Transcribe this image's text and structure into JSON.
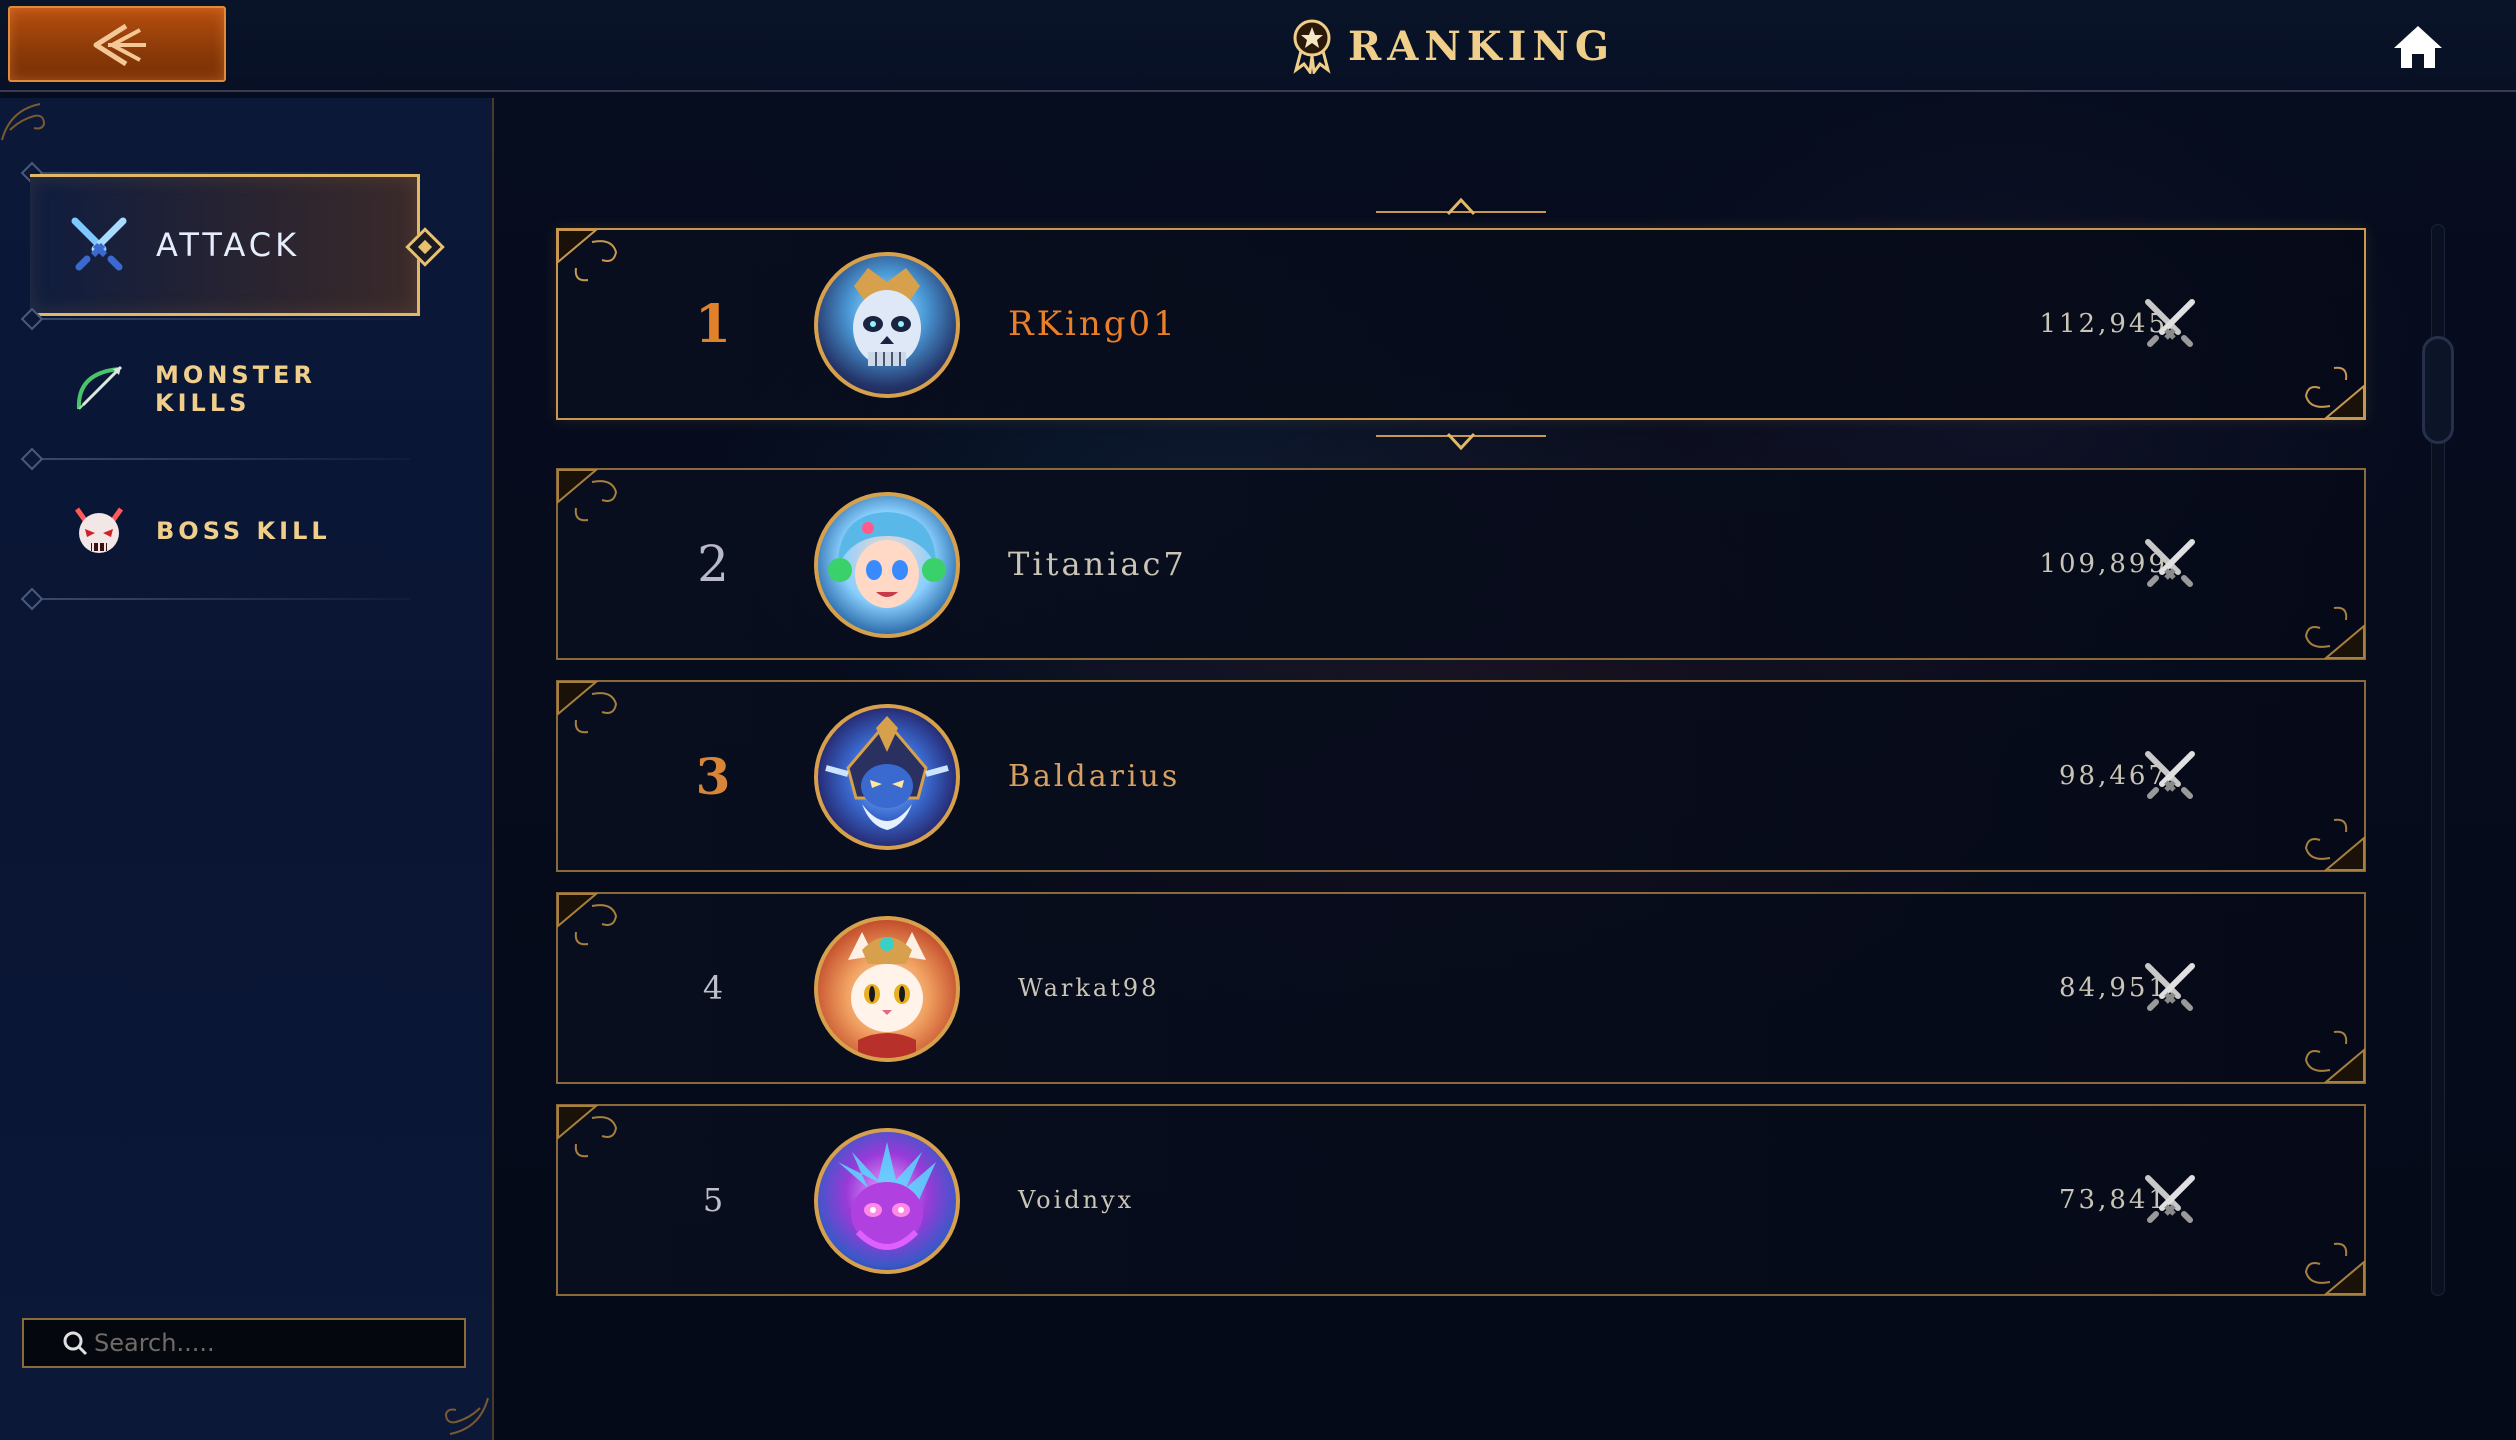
{
  "header": {
    "title": "RANKING",
    "back_icon": "back-arrow-icon",
    "home_icon": "home-icon"
  },
  "sidebar": {
    "items": [
      {
        "label": "ATTACK",
        "icon": "crossed-swords-icon",
        "active": true
      },
      {
        "label": "MONSTER KILLS",
        "icon": "bow-icon",
        "active": false
      },
      {
        "label": "BOSS KILL",
        "icon": "demon-skull-icon",
        "active": false
      }
    ],
    "search": {
      "placeholder": "Search....."
    }
  },
  "rankings": [
    {
      "rank": "1",
      "name": "RKing01",
      "score": "112,945",
      "highlight": true,
      "rank_color": "#e0822a",
      "name_color": "#ea7f2a"
    },
    {
      "rank": "2",
      "name": "Titaniac7",
      "score": "109,899",
      "highlight": false,
      "rank_color": "#b8b8c8",
      "name_color": "#c9c4b6"
    },
    {
      "rank": "3",
      "name": "Baldarius",
      "score": "98,467",
      "highlight": false,
      "rank_color": "#d8853a",
      "name_color": "#d8a060"
    },
    {
      "rank": "4",
      "name": "Warkat98",
      "score": "84,951",
      "highlight": false,
      "rank_color": "#c0c0cc",
      "name_color": "#c9c4b6"
    },
    {
      "rank": "5",
      "name": "Voidnyx",
      "score": "73,841",
      "highlight": false,
      "rank_color": "#c0c0cc",
      "name_color": "#c9c4b6"
    }
  ],
  "colors": {
    "gold": "#e2b866",
    "orange_button": "#b84f0f",
    "background": "#050b1a"
  }
}
